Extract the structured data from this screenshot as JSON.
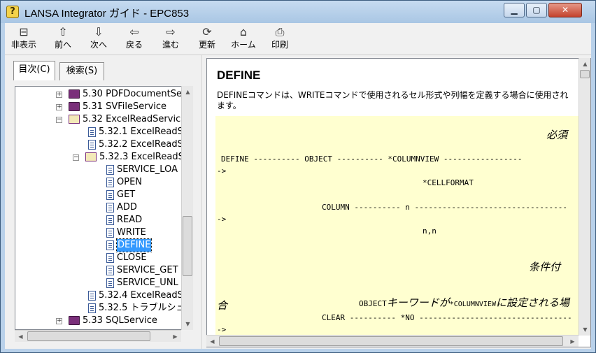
{
  "window": {
    "title": "LANSA Integrator ガイド - EPC853",
    "app_icon": "help-question-icon",
    "controls": {
      "minimize": "▁",
      "maximize": "▢",
      "close": "✕"
    }
  },
  "toolbar": {
    "buttons": [
      {
        "label": "非表示",
        "icon": "hide-pane-icon",
        "glyph": "⊟"
      },
      {
        "label": "前へ",
        "icon": "arrow-up-icon",
        "glyph": "⇧"
      },
      {
        "label": "次へ",
        "icon": "arrow-down-icon",
        "glyph": "⇩"
      },
      {
        "label": "戻る",
        "icon": "arrow-left-icon",
        "glyph": "⇦"
      },
      {
        "label": "進む",
        "icon": "arrow-right-icon",
        "glyph": "⇨"
      },
      {
        "label": "更新",
        "icon": "refresh-icon",
        "glyph": "⟳"
      },
      {
        "label": "ホーム",
        "icon": "home-icon",
        "glyph": "⌂"
      },
      {
        "label": "印刷",
        "icon": "print-icon",
        "glyph": "⎙"
      }
    ]
  },
  "tabs": {
    "toc": "目次(C)",
    "search": "検索(S)"
  },
  "tree": {
    "items": [
      {
        "text": "5.30 PDFDocumentSe",
        "expander": "+",
        "icon": "closed-book-icon"
      },
      {
        "text": "5.31 SVFileService",
        "expander": "+",
        "icon": "closed-book-icon"
      },
      {
        "text": "5.32 ExcelReadServic",
        "expander": "−",
        "icon": "open-book-icon"
      },
      {
        "text": "5.32.1 ExcelReadS",
        "expander": "",
        "icon": "page-icon"
      },
      {
        "text": "5.32.2 ExcelReadS",
        "expander": "",
        "icon": "page-icon"
      },
      {
        "text": "5.32.3 ExcelReadS",
        "expander": "−",
        "icon": "open-book-icon"
      },
      {
        "text": "SERVICE_LOA",
        "expander": "",
        "icon": "page-icon"
      },
      {
        "text": "OPEN",
        "expander": "",
        "icon": "page-icon"
      },
      {
        "text": "GET",
        "expander": "",
        "icon": "page-icon"
      },
      {
        "text": "ADD",
        "expander": "",
        "icon": "page-icon"
      },
      {
        "text": "READ",
        "expander": "",
        "icon": "page-icon"
      },
      {
        "text": "WRITE",
        "expander": "",
        "icon": "page-icon"
      },
      {
        "text": "DEFINE",
        "expander": "",
        "icon": "page-icon"
      },
      {
        "text": "CLOSE",
        "expander": "",
        "icon": "page-icon"
      },
      {
        "text": "SERVICE_GET",
        "expander": "",
        "icon": "page-icon"
      },
      {
        "text": "SERVICE_UNL",
        "expander": "",
        "icon": "page-icon"
      },
      {
        "text": "5.32.4 ExcelReadS",
        "expander": "",
        "icon": "page-icon"
      },
      {
        "text": "5.32.5 トラブルシュ",
        "expander": "",
        "icon": "page-icon"
      },
      {
        "text": "5.33 SQLService",
        "expander": "+",
        "icon": "closed-book-icon"
      }
    ],
    "selected": "DEFINE"
  },
  "content": {
    "title": "DEFINE",
    "description": "DEFINEコマンドは、WRITEコマンドで使用されるセル形式や列幅を定義する場合に使用されます。",
    "syntax": {
      "required_label": "必須",
      "conditional_label": "条件付",
      "line1_keyword": "DEFINE ---------- OBJECT ---------- *COLUMNVIEW -----------------",
      "line1_cont": "->",
      "line2": "*CELLFORMAT",
      "line3": "COLUMN ---------- n ---------------------------------",
      "line3_cont": "->",
      "line4": "n,n",
      "line5_a": "OBJECT",
      "line5_b": "キーワードが",
      "line5_c": "*COLUMNVIEW",
      "line5_d": "に設定される場",
      "line5_e": "合",
      "line6": "CLEAR ---------- *NO ---------------------------------",
      "line6_cont": "->"
    }
  },
  "colors": {
    "syntax_bg": "#ffffd0",
    "selection": "#3399ff",
    "title_bar": "#b9d1ea"
  }
}
